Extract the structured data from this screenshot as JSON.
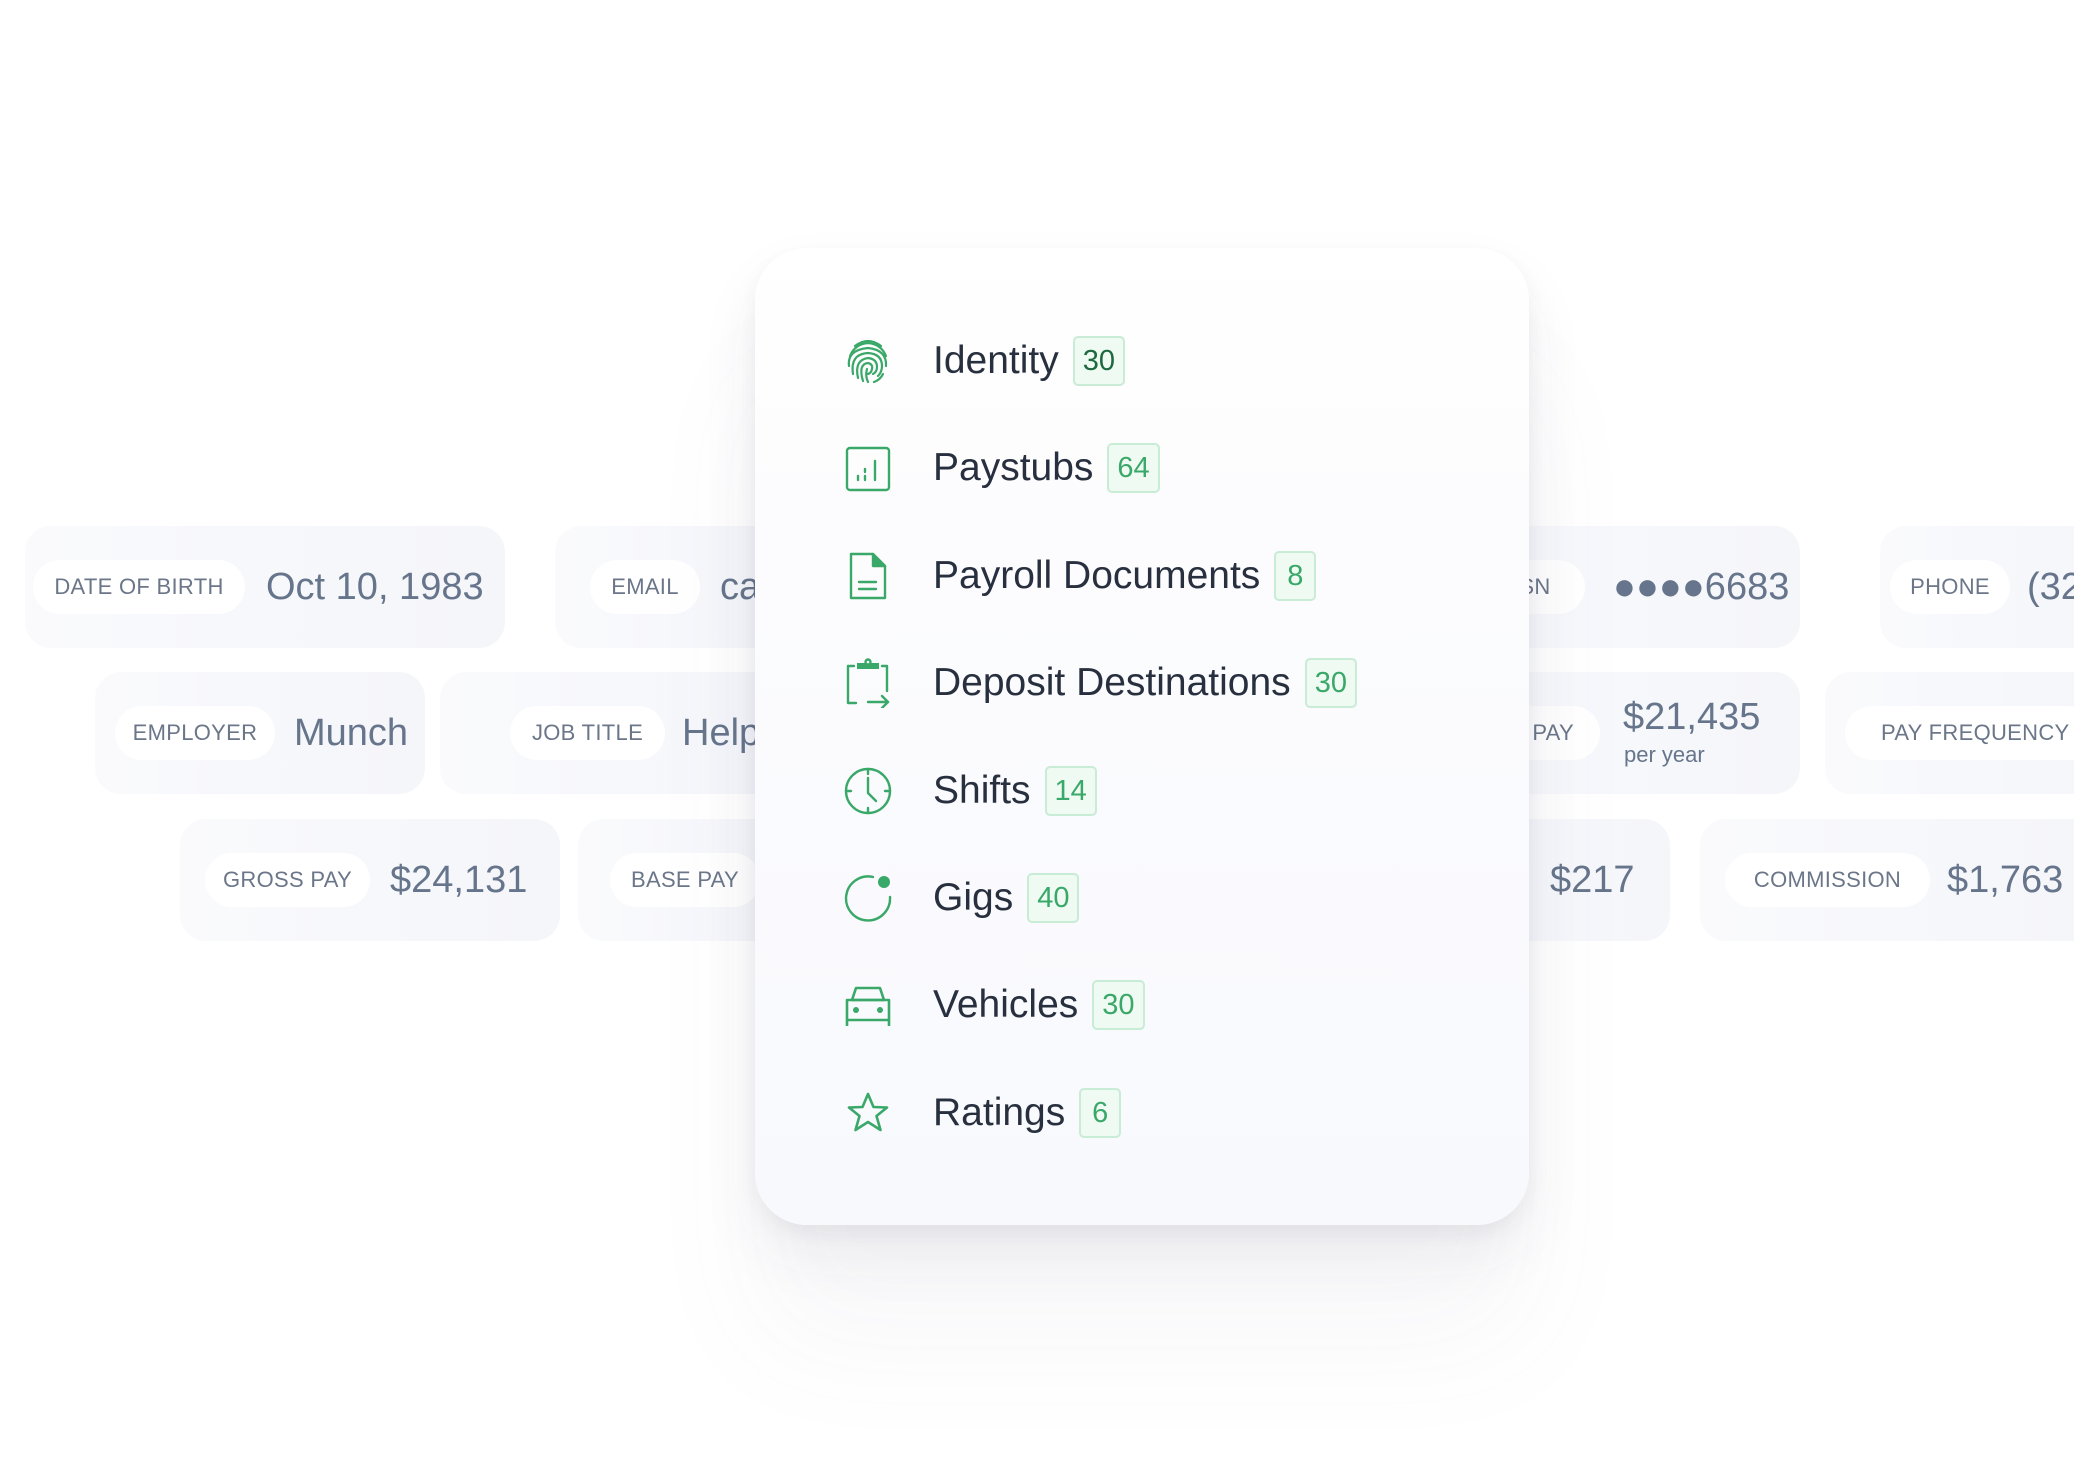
{
  "menu": {
    "items": [
      {
        "label": "Identity",
        "count": "30",
        "icon": "fingerprint-icon"
      },
      {
        "label": "Paystubs",
        "count": "64",
        "icon": "paystub-chart-icon"
      },
      {
        "label": "Payroll Documents",
        "count": "8",
        "icon": "document-icon"
      },
      {
        "label": "Deposit Destinations",
        "count": "30",
        "icon": "clipboard-transfer-icon"
      },
      {
        "label": "Shifts",
        "count": "14",
        "icon": "clock-icon"
      },
      {
        "label": "Gigs",
        "count": "40",
        "icon": "gig-circle-icon"
      },
      {
        "label": "Vehicles",
        "count": "30",
        "icon": "car-icon"
      },
      {
        "label": "Ratings",
        "count": "6",
        "icon": "star-icon"
      }
    ]
  },
  "fields": {
    "date_of_birth": {
      "label": "DATE OF BIRTH",
      "value": "Oct 10, 1983"
    },
    "email": {
      "label": "EMAIL",
      "value": "ca"
    },
    "ssn": {
      "label": "SSN",
      "value": "●●●●6683"
    },
    "phone": {
      "label": "PHONE",
      "value": "(32"
    },
    "employer": {
      "label": "EMPLOYER",
      "value": "Munch"
    },
    "job_title": {
      "label": "JOB TITLE",
      "value": "Help"
    },
    "base_pay_annual": {
      "label": "BASE PAY",
      "value": "$21,435",
      "sub": "per year"
    },
    "pay_frequency": {
      "label": "PAY FREQUENCY",
      "value": ""
    },
    "gross_pay": {
      "label": "GROSS PAY",
      "value": "$24,131"
    },
    "base_pay": {
      "label": "BASE PAY",
      "value": ""
    },
    "bonus": {
      "label": "",
      "value": "$217"
    },
    "commission": {
      "label": "COMMISSION",
      "value": "$1,763"
    }
  },
  "colors": {
    "accent_green": "#3aa868",
    "badge_bg": "#eefaf2",
    "badge_border": "#c9ecd6",
    "text_dark": "#28303f",
    "text_muted": "#66758b"
  }
}
